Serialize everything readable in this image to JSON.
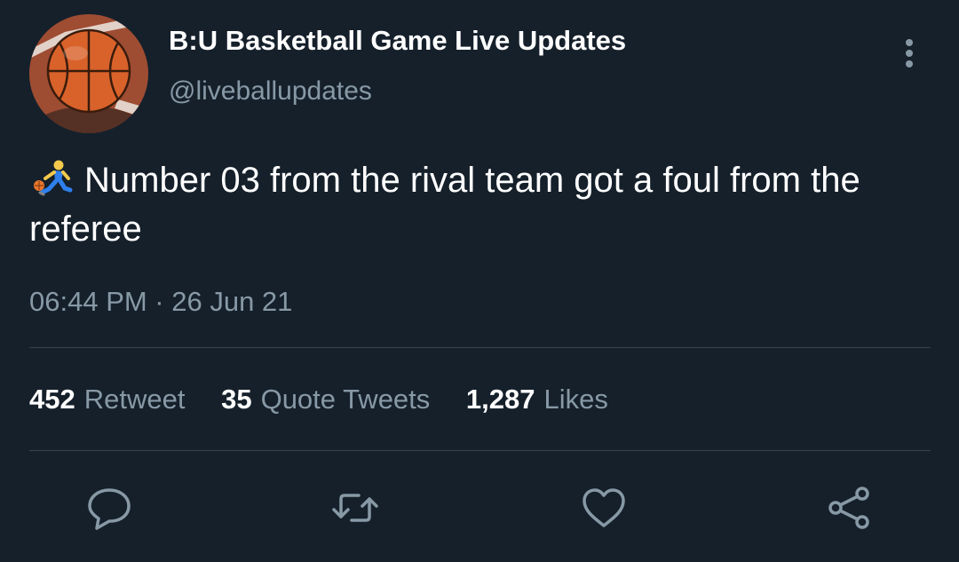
{
  "tweet": {
    "author": {
      "display_name": "B:U Basketball Game Live Updates",
      "handle": "@liveballupdates",
      "avatar_icon": "basketball-avatar"
    },
    "text": "Number 03 from the rival team got a foul from the referee",
    "emoji_icon": "person-bouncing-ball-emoji",
    "timestamp": "06:44 PM · 26 Jun 21",
    "stats": {
      "retweets": "452",
      "retweets_label": "Retweet",
      "quote_tweets": "35",
      "quote_tweets_label": "Quote Tweets",
      "likes": "1,287",
      "likes_label": "Likes"
    },
    "actions": [
      "reply-icon",
      "retweet-icon",
      "like-icon",
      "share-icon"
    ],
    "more_icon": "more-vertical-icon"
  },
  "colors": {
    "background": "#15202b",
    "primary_text": "#ffffff",
    "secondary_text": "#8899a6",
    "divider": "#38444d"
  }
}
